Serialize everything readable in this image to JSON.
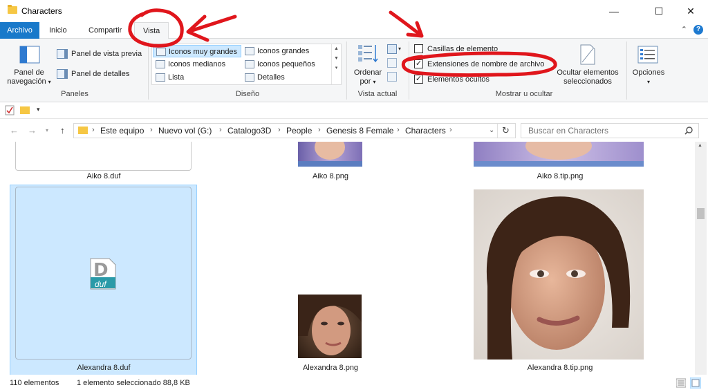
{
  "window": {
    "title": "Characters",
    "minimize": "—",
    "maximize": "☐",
    "close": "✕"
  },
  "tabs": {
    "file": "Archivo",
    "home": "Inicio",
    "share": "Compartir",
    "view": "Vista"
  },
  "ribbon": {
    "panes": {
      "nav_pane_line1": "Panel de",
      "nav_pane_line2": "navegación",
      "preview_pane": "Panel de vista previa",
      "details_pane": "Panel de detalles",
      "label": "Paneles"
    },
    "layout": {
      "items": [
        "Iconos muy grandes",
        "Iconos grandes",
        "Iconos medianos",
        "Iconos pequeños",
        "Lista",
        "Detalles"
      ],
      "label": "Diseño"
    },
    "current_view": {
      "sort_line1": "Ordenar",
      "sort_line2": "por",
      "label": "Vista actual"
    },
    "show_hide": {
      "item_checkboxes": "Casillas de elemento",
      "file_extensions": "Extensiones de nombre de archivo",
      "hidden_items": "Elementos ocultos",
      "hide_selected_line1": "Ocultar elementos",
      "hide_selected_line2": "seleccionados",
      "label": "Mostrar u ocultar"
    },
    "options": "Opciones"
  },
  "address": {
    "crumbs": [
      "Este equipo",
      "Nuevo vol (G:)",
      "Catalogo3D",
      "People",
      "Genesis 8 Female",
      "Characters"
    ]
  },
  "search": {
    "placeholder": "Buscar en Characters"
  },
  "files": {
    "aiko_duf": "Aiko 8.duf",
    "aiko_png": "Aiko 8.png",
    "aiko_tip": "Aiko 8.tip.png",
    "alexandra_duf": "Alexandra 8.duf",
    "alexandra_png": "Alexandra 8.png",
    "alexandra_tip": "Alexandra 8.tip.png",
    "duf_badge": "duf"
  },
  "status": {
    "count": "110 elementos",
    "selection": "1 elemento seleccionado  88,8 KB"
  },
  "colors": {
    "accent": "#1979ca",
    "selection": "#cce8ff",
    "annotation": "#e0161c"
  }
}
